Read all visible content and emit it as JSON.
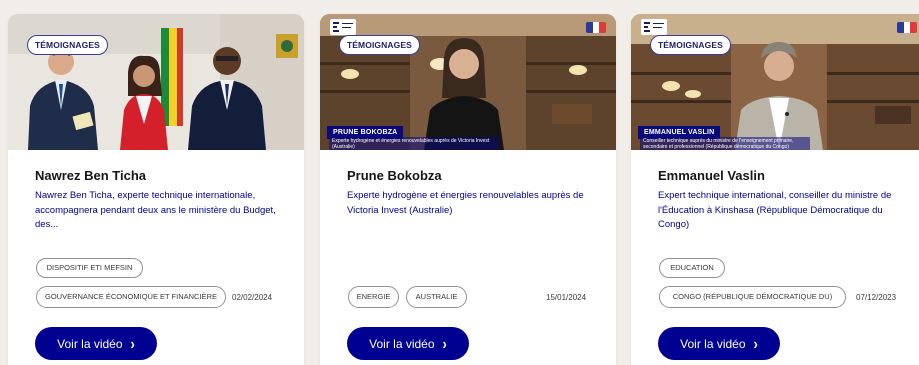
{
  "colors": {
    "accent": "#000091",
    "pill_border": "#3c3c96",
    "chip_border": "#929292"
  },
  "cards": [
    {
      "tag": "TÉMOIGNAGES",
      "title": "Nawrez Ben Ticha",
      "description": "Nawrez Ben Ticha, experte technique internationale, accompagnera pendant deux ans le ministère du Budget, des...",
      "chips": [
        "DISPOSITIF ETI MEFSIN",
        "GOUVERNANCE ÉCONOMIQUE ET FINANCIÈRE"
      ],
      "date": "02/02/2024",
      "cta": "Voir la vidéo",
      "cta_icon": "chevron-right-icon"
    },
    {
      "tag": "TÉMOIGNAGES",
      "title": "Prune Bokobza",
      "description": "Experte hydrogène et énergies renouvelables auprès de Victoria Invest (Australie)",
      "video_name": "PRUNE BOKOBZA",
      "video_caption": "Experte hydrogène et énergies renouvelables auprès de Victoria Invest (Australie)",
      "chips": [
        "ENERGIE",
        "AUSTRALIE"
      ],
      "date": "15/01/2024",
      "cta": "Voir la vidéo",
      "cta_icon": "chevron-right-icon"
    },
    {
      "tag": "TÉMOIGNAGES",
      "title": "Emmanuel Vaslin",
      "description": "Expert technique international, conseiller du ministre de l'Éducation à Kinshasa (République Démocratique du Congo)",
      "video_name": "EMMANUEL VASLIN",
      "video_caption": "Conseiller technique auprès du ministre de l'enseignement primaire, secondaire et professionnel (République démocratique du Congo)",
      "chips": [
        "EDUCATION",
        "CONGO (RÉPUBLIQUE DÉMOCRATIQUE DU)"
      ],
      "date": "07/12/2023",
      "cta": "Voir la vidéo",
      "cta_icon": "chevron-right-icon"
    }
  ]
}
